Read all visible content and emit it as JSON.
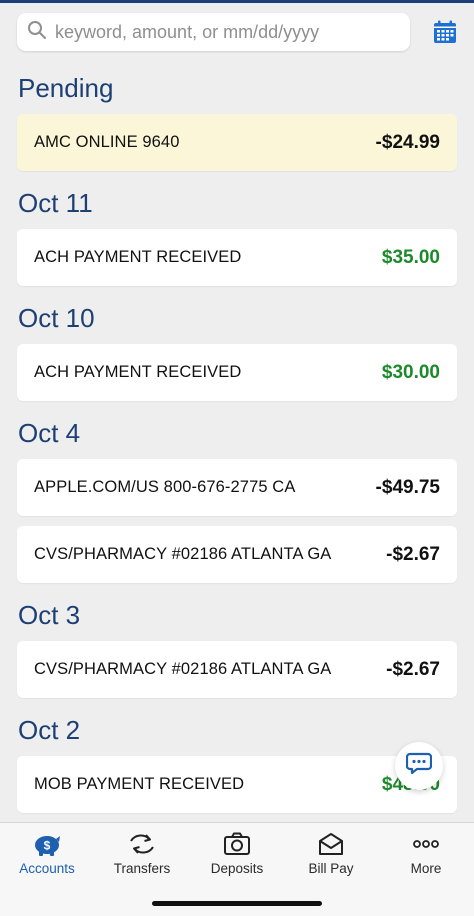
{
  "search": {
    "placeholder": "keyword, amount, or mm/dd/yyyy"
  },
  "icons": {
    "search": "search-icon",
    "calendar": "calendar-icon",
    "chat": "chat-icon",
    "accounts": "piggy-bank-dollar-icon",
    "transfers": "transfer-arrows-icon",
    "deposits": "camera-icon",
    "billpay": "envelope-icon",
    "more": "ellipsis-icon"
  },
  "colors": {
    "accent": "#1d5fb0",
    "heading": "#1d3f73",
    "credit": "#1c8a2a",
    "pending_bg": "#fbf6d8"
  },
  "groups": [
    {
      "title": "Pending",
      "items": [
        {
          "desc": "AMC ONLINE 9640",
          "amount": "-$24.99",
          "type": "pending"
        }
      ]
    },
    {
      "title": "Oct 11",
      "items": [
        {
          "desc": "ACH PAYMENT RECEIVED",
          "amount": "$35.00",
          "type": "credit"
        }
      ]
    },
    {
      "title": "Oct 10",
      "items": [
        {
          "desc": "ACH PAYMENT RECEIVED",
          "amount": "$30.00",
          "type": "credit"
        }
      ]
    },
    {
      "title": "Oct 4",
      "items": [
        {
          "desc": "APPLE.COM/US 800-676-2775 CA",
          "amount": "-$49.75",
          "type": "debit"
        },
        {
          "desc": "CVS/PHARMACY #02186 ATLANTA GA",
          "amount": "-$2.67",
          "type": "debit"
        }
      ]
    },
    {
      "title": "Oct 3",
      "items": [
        {
          "desc": "CVS/PHARMACY #02186 ATLANTA GA",
          "amount": "-$2.67",
          "type": "debit"
        }
      ]
    },
    {
      "title": "Oct 2",
      "items": [
        {
          "desc": "MOB PAYMENT RECEIVED",
          "amount": "$48.00",
          "type": "credit"
        }
      ]
    }
  ],
  "tabs": [
    {
      "label": "Accounts",
      "active": true
    },
    {
      "label": "Transfers",
      "active": false
    },
    {
      "label": "Deposits",
      "active": false
    },
    {
      "label": "Bill Pay",
      "active": false
    },
    {
      "label": "More",
      "active": false
    }
  ]
}
